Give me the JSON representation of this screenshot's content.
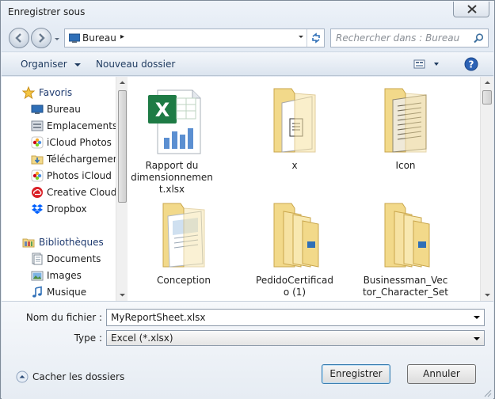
{
  "window": {
    "title": "Enregistrer sous"
  },
  "address": {
    "location": "Bureau",
    "separator": "▸"
  },
  "search": {
    "placeholder": "Rechercher dans : Bureau"
  },
  "toolbar": {
    "organize": "Organiser",
    "new_folder": "Nouveau dossier"
  },
  "nav": {
    "favorites": {
      "label": "Favoris",
      "items": [
        {
          "label": "Bureau",
          "icon": "desktop-icon"
        },
        {
          "label": "Emplacements r",
          "icon": "recent-places-icon"
        },
        {
          "label": "iCloud Photos",
          "icon": "icloud-photos-icon"
        },
        {
          "label": "Téléchargement",
          "icon": "downloads-folder-icon"
        },
        {
          "label": "Photos iCloud",
          "icon": "icloud-photos-icon"
        },
        {
          "label": "Creative Cloud F",
          "icon": "creative-cloud-icon"
        },
        {
          "label": "Dropbox",
          "icon": "dropbox-icon"
        }
      ]
    },
    "libraries": {
      "label": "Bibliothèques",
      "items": [
        {
          "label": "Documents",
          "icon": "documents-icon"
        },
        {
          "label": "Images",
          "icon": "pictures-icon"
        },
        {
          "label": "Musique",
          "icon": "music-icon"
        }
      ]
    }
  },
  "files": [
    {
      "name": "Rapport du dimensionnement.xlsx",
      "lines": [
        "Rapport du",
        "dimensionnemen",
        "t.xlsx"
      ],
      "type": "excel"
    },
    {
      "name": "x",
      "lines": [
        "x"
      ],
      "type": "folder-doc"
    },
    {
      "name": "Icon",
      "lines": [
        "Icon"
      ],
      "type": "folder-paper"
    },
    {
      "name": "Conception",
      "lines": [
        "Conception"
      ],
      "type": "folder-pages"
    },
    {
      "name": "PedidoCertificado (1)",
      "lines": [
        "PedidoCertificad",
        "o (1)"
      ],
      "type": "folder-stack"
    },
    {
      "name": "Businessman_Vector_Character_Set",
      "lines": [
        "Businessman_Vec",
        "tor_Character_Set"
      ],
      "type": "folder-stack"
    }
  ],
  "form": {
    "filename_label": "Nom du fichier :",
    "filename_value": "MyReportSheet.xlsx",
    "type_label": "Type :",
    "type_value": "Excel (*.xlsx)"
  },
  "footer": {
    "hide_folders": "Cacher les dossiers",
    "save": "Enregistrer",
    "cancel": "Annuler"
  },
  "colors": {
    "folder": "#f2d98a",
    "accent": "#3c7fb1",
    "excel_green": "#1e7b45"
  }
}
